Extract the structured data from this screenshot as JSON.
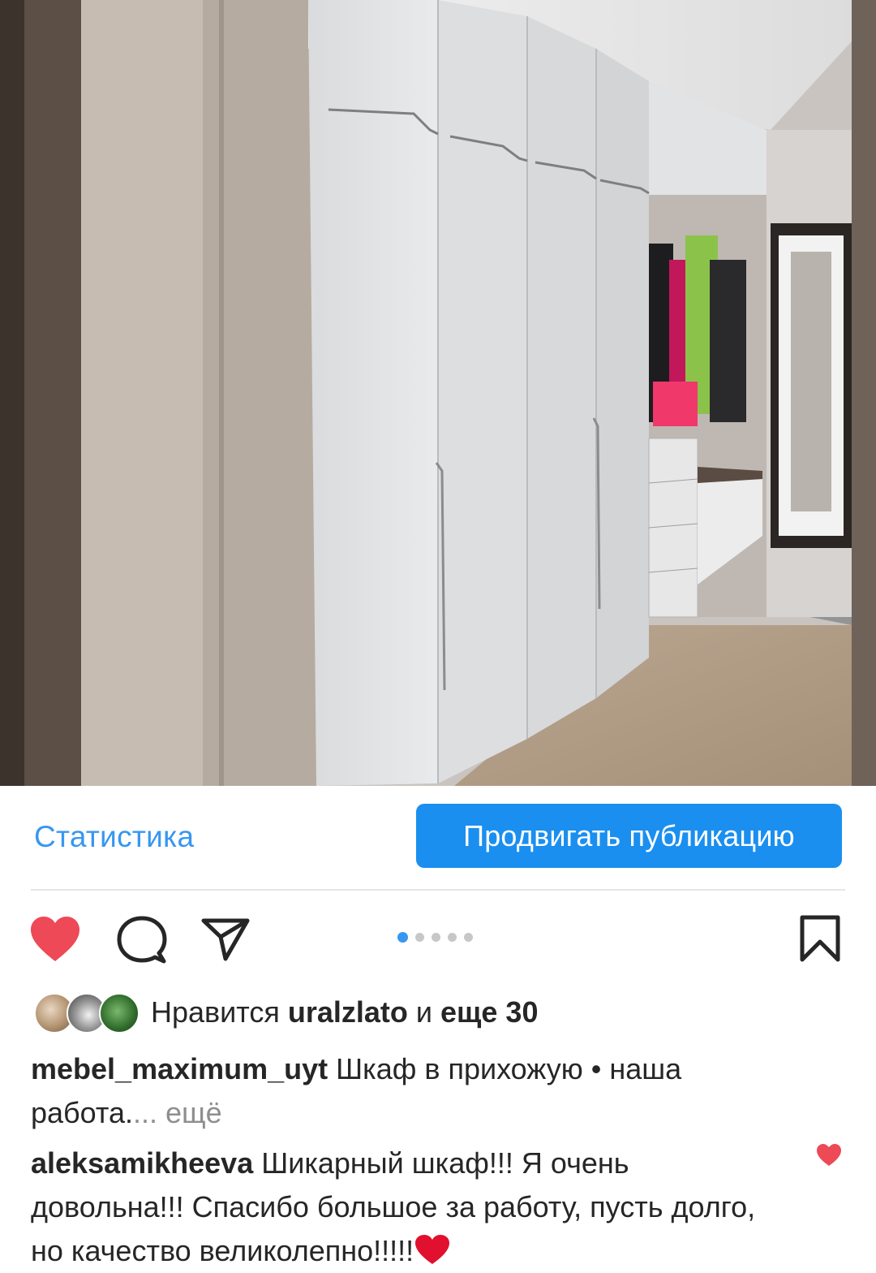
{
  "post": {
    "image_alt": "hallway-wardrobe-photo",
    "carousel": {
      "count": 5,
      "active": 1
    }
  },
  "actions": {
    "stats_label": "Статистика",
    "promote_label": "Продвигать публикацию"
  },
  "likes": {
    "prefix": "Нравится ",
    "user": "uralzlato",
    "connector": " и ",
    "others": "еще 30"
  },
  "caption": {
    "username": "mebel_maximum_uyt",
    "text": " Шкаф в прихожую • наша работа.",
    "more": "... ещё"
  },
  "comment": {
    "username": "aleksamikheeva",
    "text": " Шикарный шкаф!!! Я очень довольна!!! Спасибо большое за работу, пусть долго, но качество великолепно!!!!!"
  },
  "colors": {
    "accent": "#3797f0",
    "button": "#1a8ff0",
    "like": "#ed4956",
    "text": "#262626",
    "muted": "#8e8e8e"
  },
  "icons": [
    "heart-icon",
    "comment-icon",
    "share-icon",
    "bookmark-icon",
    "heart-emoji"
  ]
}
